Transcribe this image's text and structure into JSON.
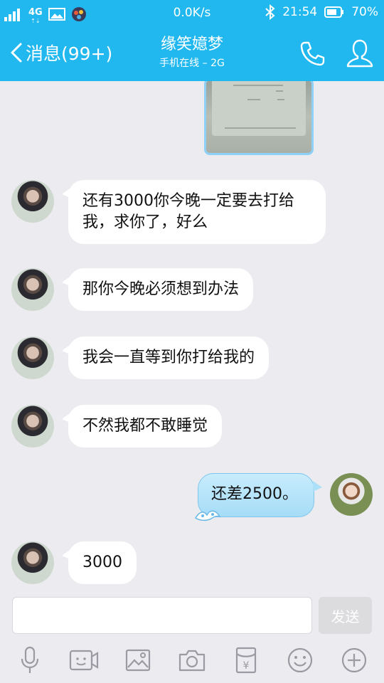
{
  "status_bar": {
    "network_type": "4G",
    "network_arrows": "⇡⇣",
    "speed": "0.0K/s",
    "time": "21:54",
    "battery": "70%"
  },
  "header": {
    "back_label": "消息(99+)",
    "contact_name": "缘笑嬑梦",
    "contact_status": "手机在线 – 2G"
  },
  "messages": [
    {
      "side": "in",
      "text": "还有3000你今晚一定要去打给我，求你了，好么"
    },
    {
      "side": "in",
      "text": "那你今晚必须想到办法"
    },
    {
      "side": "in",
      "text": "我会一直等到你打给我的"
    },
    {
      "side": "in",
      "text": "不然我都不敢睡觉"
    },
    {
      "side": "out",
      "text": "还差2500。"
    },
    {
      "side": "in",
      "text": "3000"
    }
  ],
  "composer": {
    "placeholder": "",
    "send_label": "发送"
  },
  "toolbar": {
    "icons": [
      "microphone-icon",
      "video-icon",
      "image-icon",
      "camera-icon",
      "red-packet-icon",
      "emoji-icon",
      "plus-icon"
    ]
  },
  "colors": {
    "header": "#21b8f0",
    "background": "#ececf0",
    "incoming_bubble": "#ffffff",
    "outgoing_bubble": "#b3e2f9"
  }
}
